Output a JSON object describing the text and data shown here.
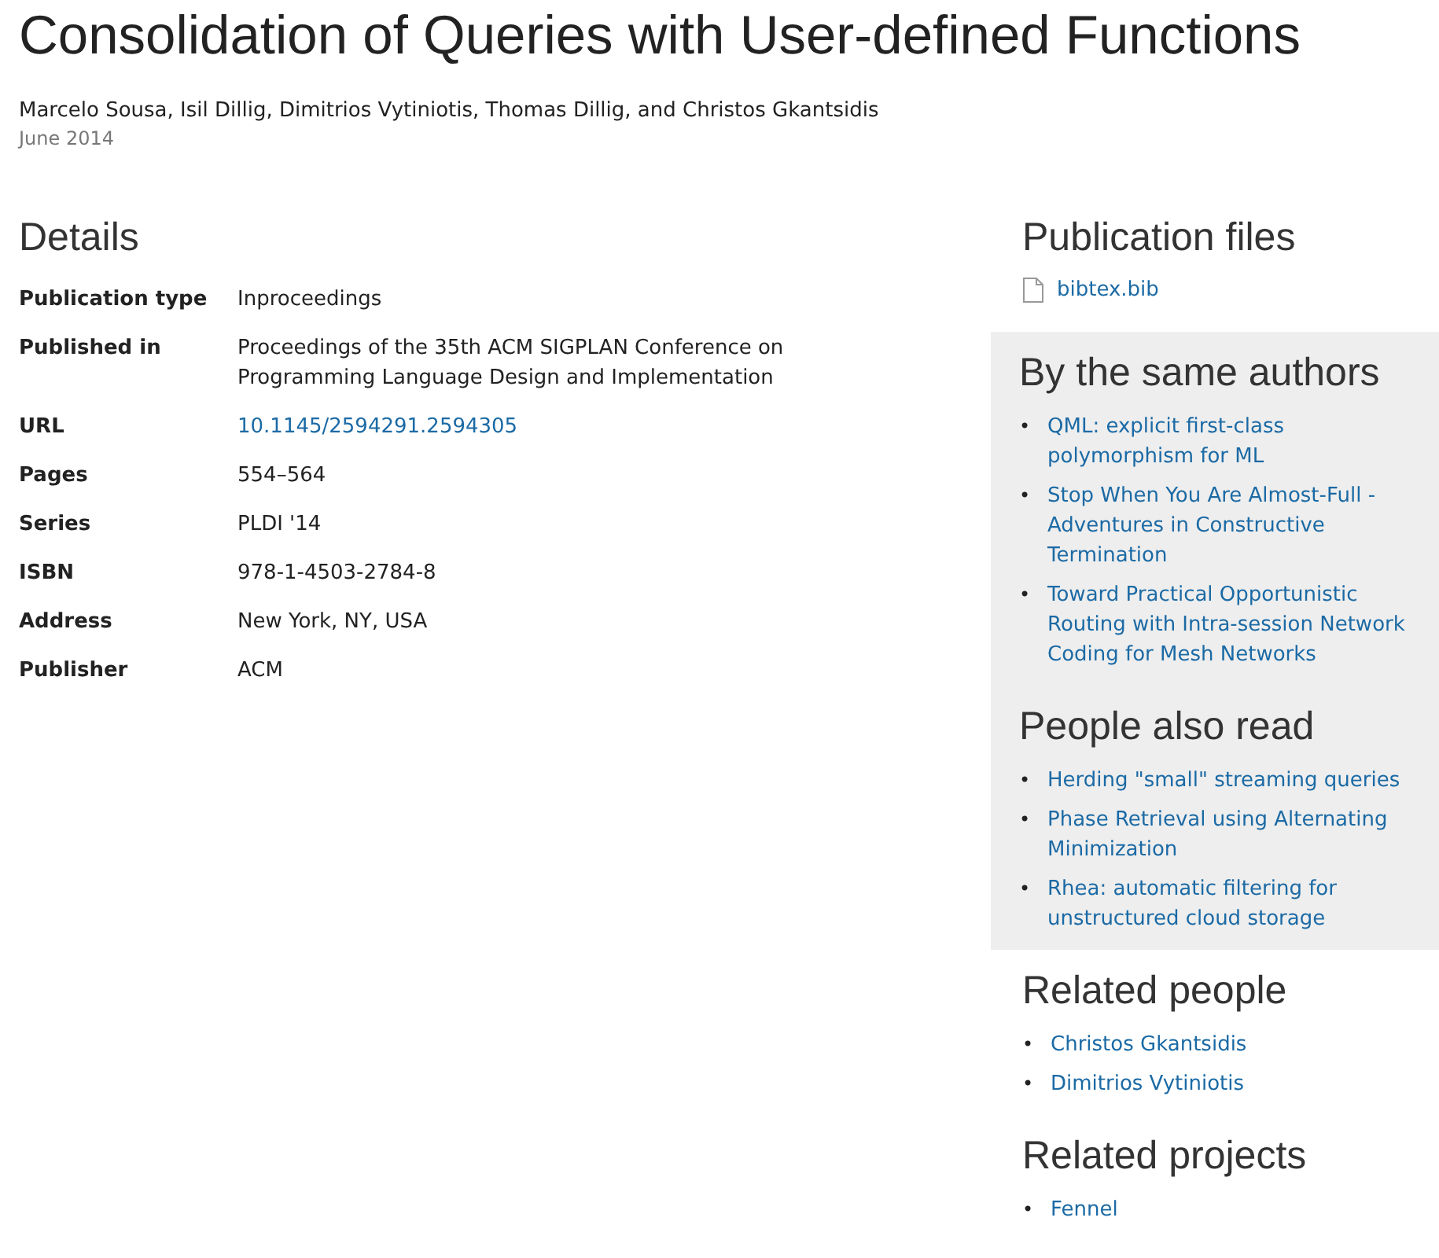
{
  "title": "Consolidation of Queries with User-defined Functions",
  "authors": "Marcelo Sousa, Isil Dillig, Dimitrios Vytiniotis, Thomas Dillig, and Christos Gkantsidis",
  "date": "June 2014",
  "details": {
    "heading": "Details",
    "rows": [
      {
        "label": "Publication type",
        "value": "Inproceedings",
        "kind": "text"
      },
      {
        "label": "Published in",
        "value": "Proceedings of the 35th ACM SIGPLAN Conference on Programming Language Design and Implementation",
        "kind": "text"
      },
      {
        "label": "URL",
        "value": "10.1145/2594291.2594305",
        "kind": "link"
      },
      {
        "label": "Pages",
        "value": "554–564",
        "kind": "text"
      },
      {
        "label": "Series",
        "value": "PLDI '14",
        "kind": "text"
      },
      {
        "label": "ISBN",
        "value": "978-1-4503-2784-8",
        "kind": "text"
      },
      {
        "label": "Address",
        "value": "New York, NY, USA",
        "kind": "text"
      },
      {
        "label": "Publisher",
        "value": "ACM",
        "kind": "text"
      }
    ]
  },
  "sidebar": [
    {
      "heading": "Publication files",
      "kind": "files",
      "shaded": false,
      "items": [
        "bibtex.bib"
      ]
    },
    {
      "heading": "By the same authors",
      "kind": "list",
      "marker": "•",
      "shaded": true,
      "items": [
        "QML: explicit first-class polymorphism for ML",
        "Stop When You Are Almost-Full - Adventures in Constructive Termination",
        "Toward Practical Opportunistic Routing with Intra-session Network Coding for Mesh Networks"
      ]
    },
    {
      "heading": "People also read",
      "kind": "list",
      "marker": "•",
      "shaded": true,
      "items": [
        "Herding \"small\" streaming queries",
        "Phase Retrieval using Alternating Minimization",
        "Rhea: automatic filtering for unstructured cloud storage"
      ]
    },
    {
      "heading": "Related people",
      "kind": "list",
      "marker": "•",
      "shaded": false,
      "items": [
        "Christos Gkantsidis",
        "Dimitrios Vytiniotis"
      ]
    },
    {
      "heading": "Related projects",
      "kind": "list",
      "marker": "•",
      "shaded": false,
      "items": [
        "Fennel"
      ]
    }
  ]
}
